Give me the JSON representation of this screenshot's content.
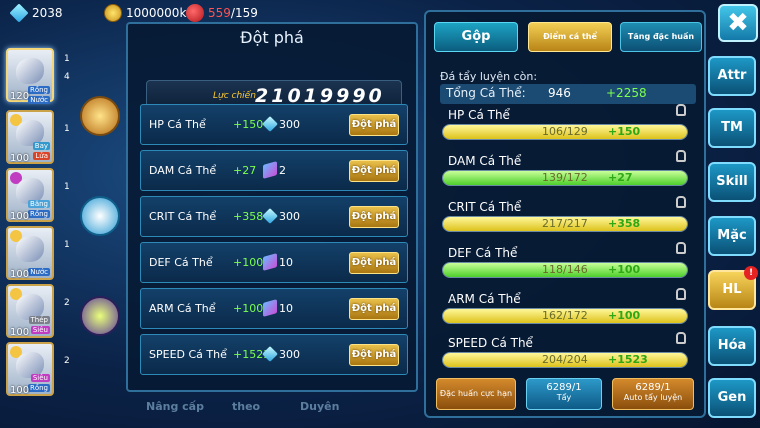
{
  "topbar": {
    "gems": "2038",
    "coins": "1000000k",
    "stamina_current": "559",
    "stamina_max": "/159"
  },
  "roster": [
    {
      "level": "120",
      "type": "Rồng",
      "type2": "Nước",
      "count": "1",
      "count2": "4",
      "type_color": "#2d6cc4"
    },
    {
      "level": "100",
      "type": "Bay",
      "type2": "Lửa",
      "count": "1",
      "type_color": "#3399cc"
    },
    {
      "level": "100",
      "type": "Băng",
      "type2": "Rồng",
      "count": "1",
      "type_color": "#4aa3d8"
    },
    {
      "level": "100",
      "type": "Nước",
      "count": "1",
      "type_color": "#2d6cc4"
    },
    {
      "level": "100",
      "type": "Thép",
      "type2": "Siêu",
      "count": "2",
      "type_color": "#7a7f8a"
    },
    {
      "level": "100",
      "type": "Siêu",
      "type2": "Rồng",
      "count": "2",
      "type_color": "#c03cc0"
    }
  ],
  "left_panel": {
    "title": "Đột phá",
    "power_label": "Lực chiến",
    "power_value": "21019990",
    "rows": [
      {
        "name": "HP Cá Thể",
        "inc": "+150",
        "cost": "300",
        "cost_icon": "diamond-icon",
        "button": "Đột phá"
      },
      {
        "name": "DAM Cá Thể",
        "inc": "+27",
        "cost": "2",
        "cost_icon": "book-icon",
        "button": "Đột phá"
      },
      {
        "name": "CRIT Cá Thể",
        "inc": "+358",
        "cost": "300",
        "cost_icon": "diamond-icon",
        "button": "Đột phá"
      },
      {
        "name": "DEF Cá Thể",
        "inc": "+100",
        "cost": "10",
        "cost_icon": "book-icon",
        "button": "Đột phá"
      },
      {
        "name": "ARM Cá Thể",
        "inc": "+100",
        "cost": "10",
        "cost_icon": "book-icon",
        "button": "Đột phá"
      },
      {
        "name": "SPEED Cá Thể",
        "inc": "+1523",
        "cost": "300",
        "cost_icon": "diamond-icon",
        "button": "Đột phá"
      }
    ],
    "bottom_tabs": [
      "Nâng cấp",
      "theo",
      "Duyên"
    ]
  },
  "right_panel": {
    "tabs": {
      "gop": "Gộp",
      "diem": "Điểm cá thể",
      "tang": "Tăng đặc huấn"
    },
    "remaining_label": "Đá tẩy luyện còn:",
    "total_label": "Tổng Cá Thể:",
    "total_value": "946",
    "total_add": "+2258",
    "stats": [
      {
        "name": "HP Cá Thể",
        "cur": "106",
        "max": "129",
        "ratio": "106/129",
        "add": "+150",
        "fill": 1.0,
        "color": "yellow"
      },
      {
        "name": "DAM Cá Thể",
        "cur": "139",
        "max": "172",
        "ratio": "139/172",
        "add": "+27",
        "fill": 1.0,
        "color": "green"
      },
      {
        "name": "CRIT Cá Thể",
        "cur": "217",
        "max": "217",
        "ratio": "217/217",
        "add": "+358",
        "fill": 1.0,
        "color": "yellow"
      },
      {
        "name": "DEF Cá Thể",
        "cur": "118",
        "max": "146",
        "ratio": "118/146",
        "add": "+100",
        "fill": 1.0,
        "color": "green"
      },
      {
        "name": "ARM Cá Thể",
        "cur": "162",
        "max": "172",
        "ratio": "162/172",
        "add": "+100",
        "fill": 1.0,
        "color": "yellow"
      },
      {
        "name": "SPEED Cá Thể",
        "cur": "204",
        "max": "204",
        "ratio": "204/204",
        "add": "+1523",
        "fill": 1.0,
        "color": "yellow"
      }
    ],
    "buttons": {
      "dac_huan": "Đặc huấn cực hạn",
      "tay_count": "6289/1",
      "tay": "Tẩy",
      "auto_count": "6289/1",
      "auto": "Auto tẩy luyện"
    }
  },
  "side_menu": [
    "Attr",
    "TM",
    "Skill",
    "Mặc",
    "HL",
    "Hóa",
    "Gen"
  ],
  "close_label": "✖"
}
